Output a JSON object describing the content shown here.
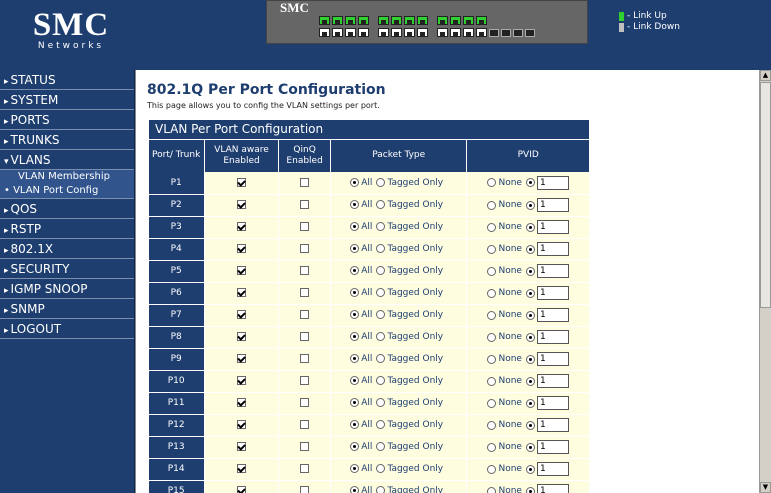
{
  "header": {
    "logo_text": "SMC",
    "logo_sub": "Networks",
    "panel_brand": "SMC",
    "legend": [
      {
        "label": "- Link Up",
        "color": "#2fd02f"
      },
      {
        "label": "- Link Down",
        "color": "#c0c0c0"
      }
    ],
    "ports_top": [
      "up",
      "up",
      "up",
      "up",
      "up",
      "up",
      "up",
      "up",
      "up",
      "up",
      "up",
      "up"
    ],
    "ports_bottom": [
      "down",
      "down",
      "down",
      "down",
      "down",
      "down",
      "down",
      "down",
      "down",
      "down",
      "down",
      "down"
    ]
  },
  "nav": {
    "items": [
      {
        "label": "STATUS",
        "arrow": "▸"
      },
      {
        "label": "SYSTEM",
        "arrow": "▸"
      },
      {
        "label": "PORTS",
        "arrow": "▸"
      },
      {
        "label": "TRUNKS",
        "arrow": "▸"
      },
      {
        "label": "VLANS",
        "arrow": "▾"
      },
      {
        "label": "QOS",
        "arrow": "▸"
      },
      {
        "label": "RSTP",
        "arrow": "▸"
      },
      {
        "label": "802.1X",
        "arrow": "▸"
      },
      {
        "label": "SECURITY",
        "arrow": "▸"
      },
      {
        "label": "IGMP SNOOP",
        "arrow": "▸"
      },
      {
        "label": "SNMP",
        "arrow": "▸"
      },
      {
        "label": "LOGOUT",
        "arrow": "▸"
      }
    ],
    "sub_items": [
      {
        "label": "VLAN Membership"
      },
      {
        "label": "• VLAN Port Config"
      }
    ]
  },
  "page": {
    "title": "802.1Q Per Port Configuration",
    "description": "This page allows you to config the VLAN settings per port."
  },
  "table": {
    "caption": "VLAN Per Port Configuration",
    "headers": [
      "Port/ Trunk",
      "VLAN aware Enabled",
      "QinQ Enabled",
      "Packet Type",
      "PVID"
    ],
    "packet_type_options": [
      "All",
      "Tagged Only"
    ],
    "pvid_options": [
      "None"
    ],
    "rows": [
      {
        "port": "P1",
        "vlan_aware": true,
        "qinq": false,
        "packet_type": "All",
        "pvid": "1"
      },
      {
        "port": "P2",
        "vlan_aware": true,
        "qinq": false,
        "packet_type": "All",
        "pvid": "1"
      },
      {
        "port": "P3",
        "vlan_aware": true,
        "qinq": false,
        "packet_type": "All",
        "pvid": "1"
      },
      {
        "port": "P4",
        "vlan_aware": true,
        "qinq": false,
        "packet_type": "All",
        "pvid": "1"
      },
      {
        "port": "P5",
        "vlan_aware": true,
        "qinq": false,
        "packet_type": "All",
        "pvid": "1"
      },
      {
        "port": "P6",
        "vlan_aware": true,
        "qinq": false,
        "packet_type": "All",
        "pvid": "1"
      },
      {
        "port": "P7",
        "vlan_aware": true,
        "qinq": false,
        "packet_type": "All",
        "pvid": "1"
      },
      {
        "port": "P8",
        "vlan_aware": true,
        "qinq": false,
        "packet_type": "All",
        "pvid": "1"
      },
      {
        "port": "P9",
        "vlan_aware": true,
        "qinq": false,
        "packet_type": "All",
        "pvid": "1"
      },
      {
        "port": "P10",
        "vlan_aware": true,
        "qinq": false,
        "packet_type": "All",
        "pvid": "1"
      },
      {
        "port": "P11",
        "vlan_aware": true,
        "qinq": false,
        "packet_type": "All",
        "pvid": "1"
      },
      {
        "port": "P12",
        "vlan_aware": true,
        "qinq": false,
        "packet_type": "All",
        "pvid": "1"
      },
      {
        "port": "P13",
        "vlan_aware": true,
        "qinq": false,
        "packet_type": "All",
        "pvid": "1"
      },
      {
        "port": "P14",
        "vlan_aware": true,
        "qinq": false,
        "packet_type": "All",
        "pvid": "1"
      },
      {
        "port": "P15",
        "vlan_aware": true,
        "qinq": false,
        "packet_type": "All",
        "pvid": "1"
      }
    ]
  }
}
